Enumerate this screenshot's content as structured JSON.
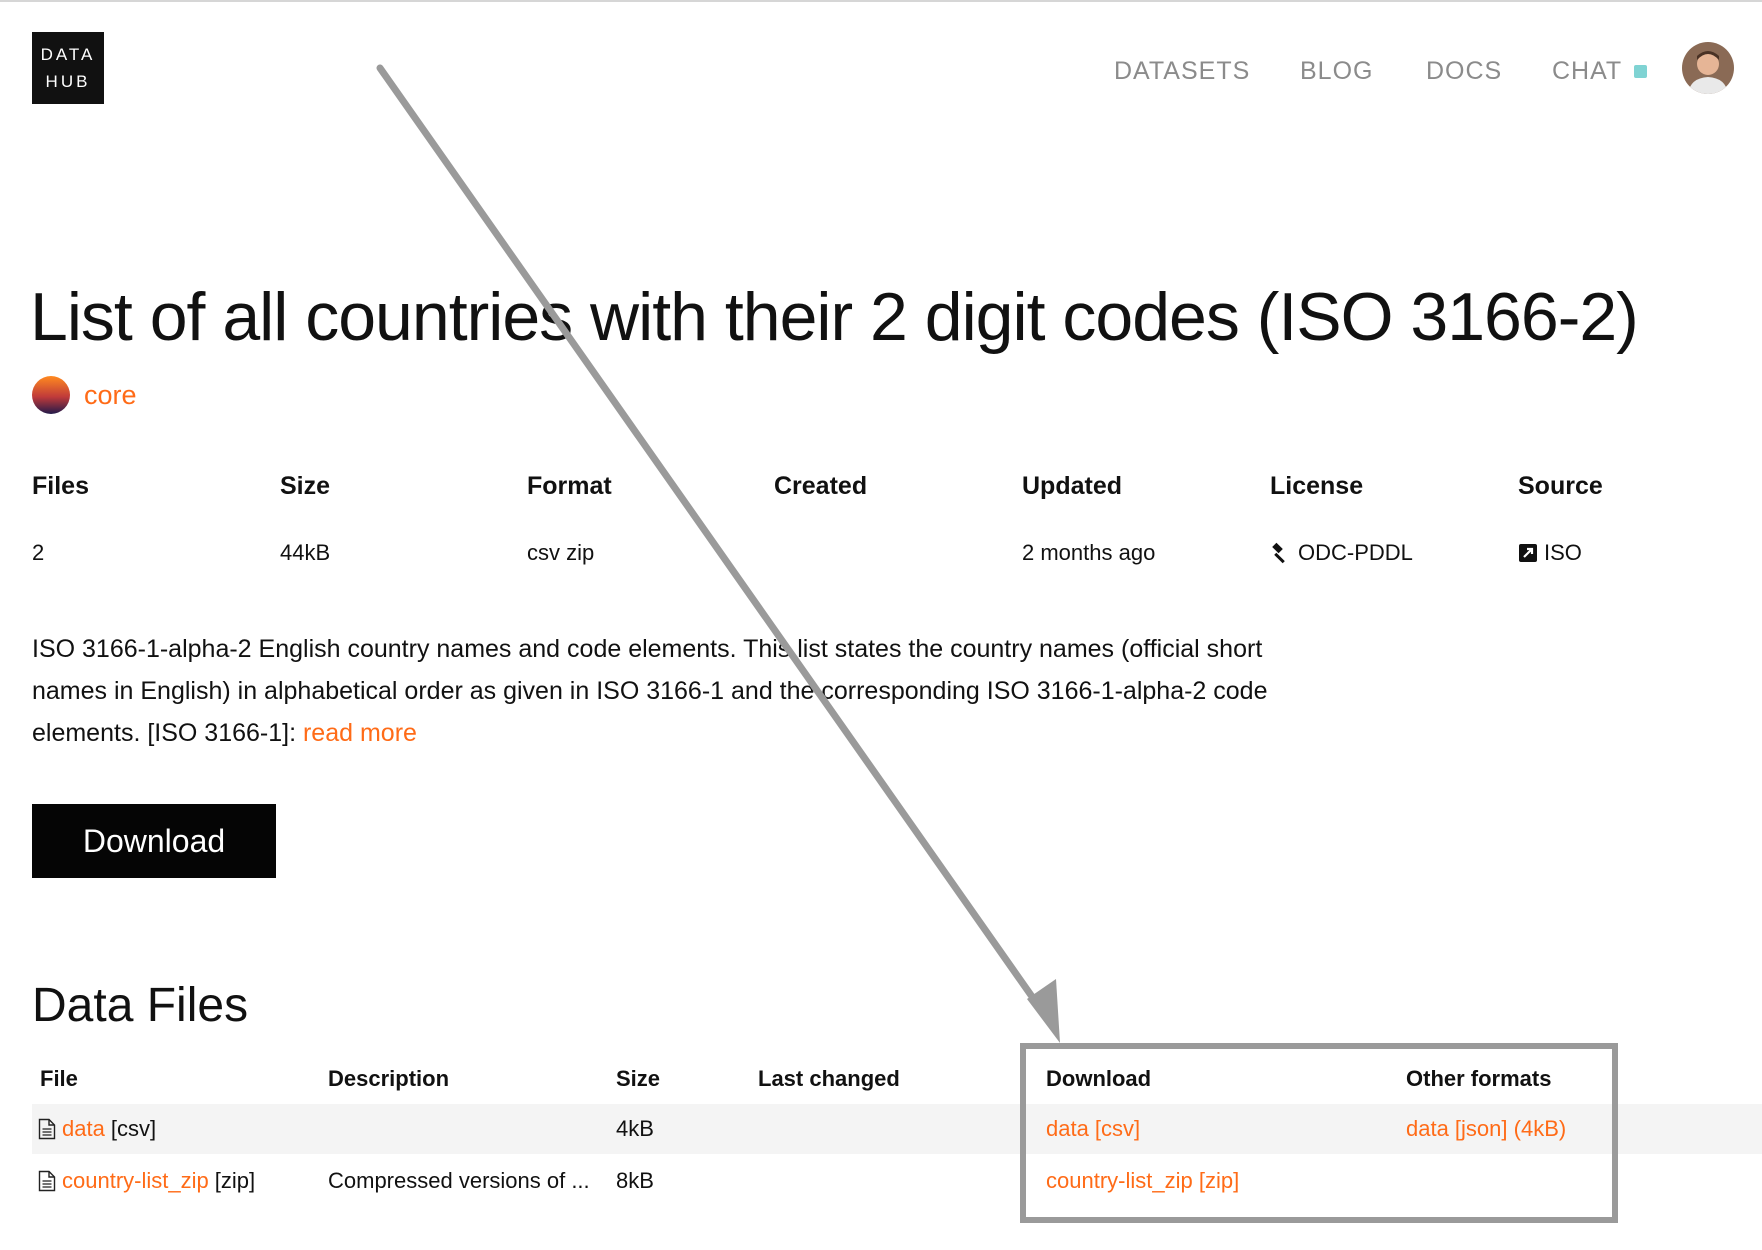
{
  "header": {
    "logo_line1": "DATA",
    "logo_line2": "HUB",
    "nav": [
      "DATASETS",
      "BLOG",
      "DOCS",
      "CHAT"
    ]
  },
  "dataset": {
    "title": "List of all countries with their 2 digit codes (ISO 3166-2)",
    "owner": "core",
    "meta_headers": [
      "Files",
      "Size",
      "Format",
      "Created",
      "Updated",
      "License",
      "Source"
    ],
    "meta_values": {
      "files": "2",
      "size": "44kB",
      "format": "csv zip",
      "created": "",
      "updated": "2 months ago",
      "license": "ODC-PDDL",
      "source": "ISO"
    },
    "description": "ISO 3166-1-alpha-2 English country names and code elements. This list states the country names (official short names in English) in alphabetical order as given in ISO 3166-1 and the corresponding ISO 3166-1-alpha-2 code elements. [ISO 3166-1]: ",
    "read_more": "read more",
    "download_label": "Download"
  },
  "data_files": {
    "title": "Data Files",
    "headers": [
      "File",
      "Description",
      "Size",
      "Last changed",
      "Download",
      "Other formats"
    ],
    "rows": [
      {
        "file": "data",
        "ext": "[csv]",
        "description": "",
        "size": "4kB",
        "last_changed": "",
        "download": "data [csv]",
        "other": "data [json] (4kB)"
      },
      {
        "file": "country-list_zip",
        "ext": "[zip]",
        "description": "Compressed versions of ...",
        "size": "8kB",
        "last_changed": "",
        "download": "country-list_zip [zip]",
        "other": ""
      }
    ]
  },
  "colors": {
    "accent": "#ff6b17",
    "nav_text": "#8b8b8b",
    "chat_indicator": "#7fd3d3",
    "annotation": "#9a9a9a"
  }
}
